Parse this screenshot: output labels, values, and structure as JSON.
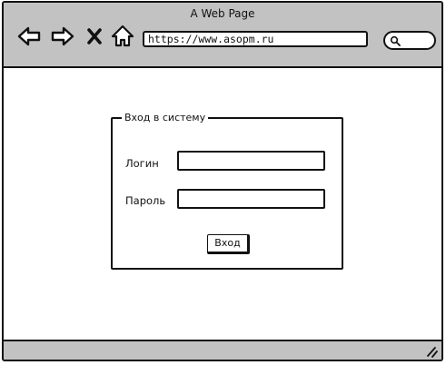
{
  "window": {
    "title": "A Web Page"
  },
  "toolbar": {
    "back_icon": "arrow-left-icon",
    "forward_icon": "arrow-right-icon",
    "stop_icon": "close-icon",
    "home_icon": "home-icon",
    "search_icon": "search-icon"
  },
  "address_bar": {
    "url": "https://www.asopm.ru"
  },
  "login_form": {
    "legend": "Вход в систему",
    "login_label": "Логин",
    "login_value": "",
    "password_label": "Пароль",
    "password_value": "",
    "submit_label": "Вход"
  },
  "colors": {
    "chrome_gray": "#c2c2c2",
    "stroke": "#111111",
    "background": "#ffffff"
  }
}
